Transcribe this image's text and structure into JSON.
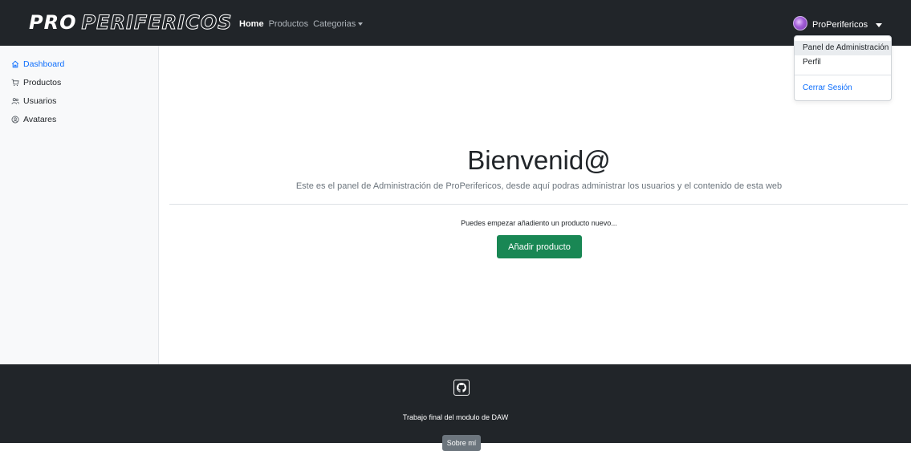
{
  "navbar": {
    "brand_bold": "PRO",
    "brand_outline": "PERIFERICOS",
    "links": [
      {
        "label": "Home",
        "active": true
      },
      {
        "label": "Productos",
        "active": false
      },
      {
        "label": "Categorias",
        "active": false
      }
    ],
    "user_name": "ProPerifericos"
  },
  "dropdown": {
    "items": [
      {
        "label": "Panel de Administración"
      },
      {
        "label": "Perfil"
      },
      {
        "label": "Cerrar Sesión"
      }
    ]
  },
  "sidebar": {
    "items": [
      {
        "label": "Dashboard",
        "icon": "house-icon",
        "active": true
      },
      {
        "label": "Productos",
        "icon": "cart-icon",
        "active": false
      },
      {
        "label": "Usuarios",
        "icon": "users-icon",
        "active": false
      },
      {
        "label": "Avatares",
        "icon": "user-circle-icon",
        "active": false
      }
    ]
  },
  "main": {
    "title": "Bienvenid@",
    "subtitle": "Este es el panel de Administración de ProPerifericos, desde aquí podras administrar los usuarios y el contenido de esta web",
    "hint": "Puedes empezar añadiento un producto nuevo...",
    "add_button": "Añadir producto"
  },
  "footer": {
    "github_icon": "github-icon",
    "text": "Trabajo final del modulo de DAW",
    "about_button": "Sobre mí"
  },
  "colors": {
    "navbar_bg": "#212529",
    "primary": "#0d6efd",
    "success": "#198754",
    "secondary": "#6c757d"
  }
}
